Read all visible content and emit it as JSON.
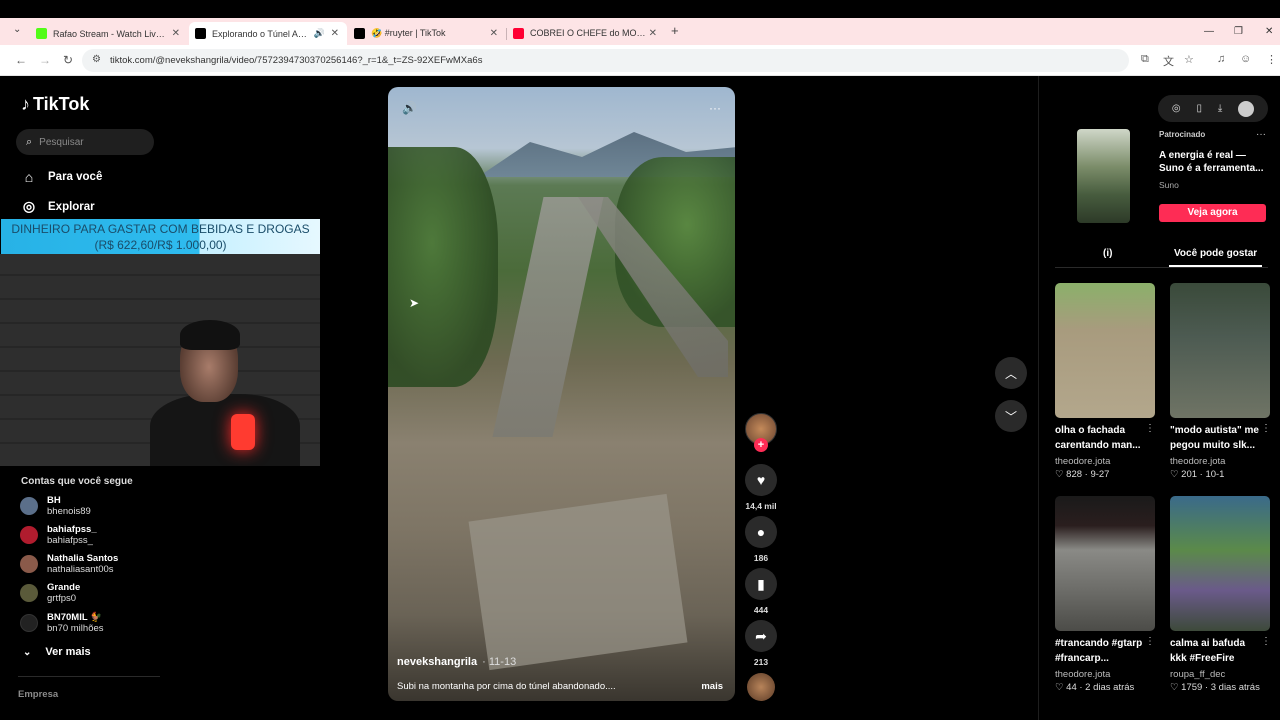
{
  "browser": {
    "tabs": [
      {
        "title": "Rafao Stream - Watch Live on K",
        "favicon_color": "#53fc18"
      },
      {
        "title": "Explorando o Túnel Abandonado",
        "favicon_color": "#000000"
      },
      {
        "title": "🤣 #ruyter | TikTok",
        "favicon_color": "#000000"
      },
      {
        "title": "COBREI O CHEFE do MORRO 😮",
        "favicon_color": "#ff0033"
      }
    ],
    "url": "tiktok.com/@nevekshangrila/video/7572394730370256146?_r=1&_t=ZS-92XEFwMXa6s",
    "new_tab_label": "+",
    "close_glyph": "✕",
    "window_controls": {
      "minimize": "—",
      "restore": "❐",
      "close": "✕"
    }
  },
  "sidebar": {
    "logo_text": "TikTok",
    "search_placeholder": "Pesquisar",
    "nav": [
      {
        "label": "Para você",
        "icon": "home-icon"
      },
      {
        "label": "Explorar",
        "icon": "compass-icon"
      }
    ],
    "following_title": "Contas que você segue",
    "accounts": [
      {
        "name": "BH",
        "handle": "bhenois89",
        "color": "#5b6f8a"
      },
      {
        "name": "bahiafpss_",
        "handle": "bahiafpss_",
        "color": "#b01c2e"
      },
      {
        "name": "Nathalia Santos",
        "handle": "nathaliasant00s",
        "color": "#8a5a4a"
      },
      {
        "name": "Grande",
        "handle": "grtfps0",
        "color": "#5a5a3a"
      },
      {
        "name": "BN70MIL 🐓",
        "handle": "bn70 milhões",
        "color": "#222222"
      }
    ],
    "see_more": "Ver mais",
    "company": "Empresa"
  },
  "overlay": {
    "donation_line1": "DINHEIRO PARA GASTAR COM BEBIDAS E DROGAS",
    "donation_line2": "(R$ 622,60/R$ 1.000,00)",
    "progress": 0.6226
  },
  "video": {
    "username": "nevekshangrila",
    "date": "· 11-13",
    "description": "Subi na montanha por cima do túnel abandonado....",
    "more": "mais"
  },
  "actions": {
    "likes": "14,4 mil",
    "comments": "186",
    "saves": "444",
    "shares": "213",
    "plus": "+"
  },
  "right_panel": {
    "ad": {
      "sponsored": "Patrocinado",
      "title": "A energia é real — Suno é a ferramenta...",
      "brand": "Suno",
      "cta": "Veja agora"
    },
    "tabs": [
      "(i)",
      "Você pode gostar"
    ],
    "cards": [
      {
        "title": "olha o fachada carentando man...",
        "user": "theodore.jota",
        "meta": "♡ 828 · 9-27"
      },
      {
        "title": "\"modo autista\" me pegou muito slk...",
        "user": "theodore.jota",
        "meta": "♡ 201 · 10-1"
      },
      {
        "title": "#trancando #gtarp #francarp...",
        "user": "theodore.jota",
        "meta": "♡ 44 · 2 dias atrás"
      },
      {
        "title": "calma ai bafuda kkk #FreeFire",
        "user": "roupa_ff_dec",
        "meta": "♡ 1759 · 3 dias atrás"
      }
    ]
  }
}
